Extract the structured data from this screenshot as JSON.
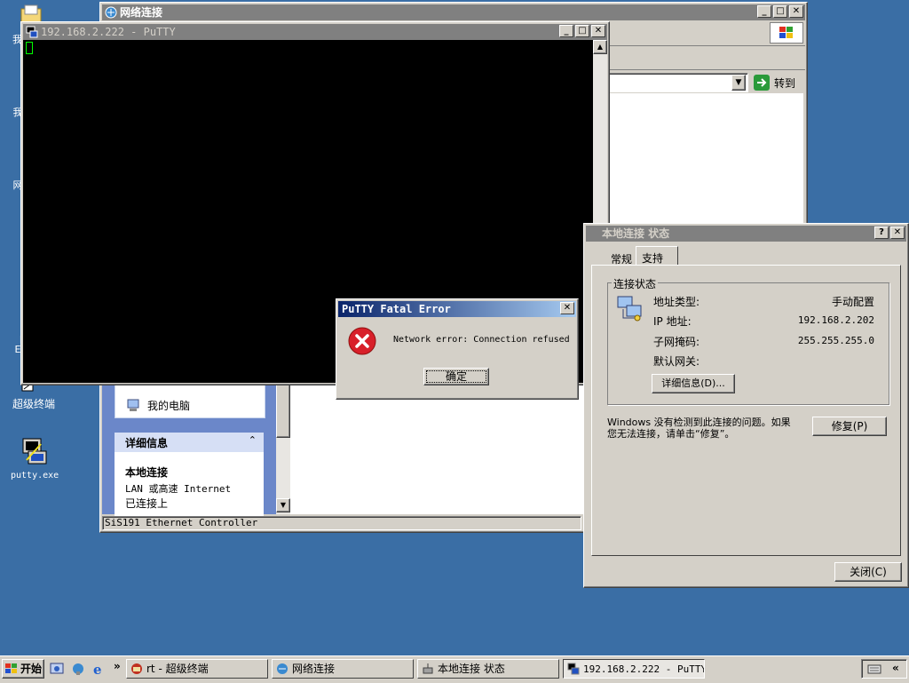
{
  "desktop": {
    "icons": [
      {
        "label": "我",
        "name": "desktop-icon-my-documents"
      },
      {
        "label": "我",
        "name": "desktop-icon-my-computer"
      },
      {
        "label": "网",
        "name": "desktop-icon-network"
      },
      {
        "label": "I\nE",
        "name": "desktop-icon-ie"
      },
      {
        "label": "超级终端",
        "name": "desktop-icon-hyperterminal"
      },
      {
        "label": "putty.exe",
        "name": "desktop-icon-putty"
      }
    ]
  },
  "netconn": {
    "title": "网络连接",
    "go_label": "转到",
    "sidebar": {
      "my_computer": "我的电脑",
      "details_header": "详细信息",
      "conn_name": "本地连接",
      "conn_type": "LAN 或高速 Internet",
      "conn_status": "已连接上"
    },
    "statusbar": "SiS191 Ethernet Controller"
  },
  "putty": {
    "title": "192.168.2.222 - PuTTY"
  },
  "fatal": {
    "title": "PuTTY Fatal Error",
    "message": "Network error: Connection refused",
    "ok_label": "确定"
  },
  "status": {
    "title": "本地连接 状态",
    "tabs": [
      "常规",
      "支持"
    ],
    "group_label": "连接状态",
    "rows": [
      {
        "label": "地址类型:",
        "value": "手动配置"
      },
      {
        "label": "IP 地址:",
        "value": "192.168.2.202"
      },
      {
        "label": "子网掩码:",
        "value": "255.255.255.0"
      },
      {
        "label": "默认网关:",
        "value": ""
      }
    ],
    "details_button": "详细信息(D)...",
    "hint_line1": "Windows 没有检测到此连接的问题。如果",
    "hint_line2": "您无法连接，请单击“修复”。",
    "repair_button": "修复(P)",
    "close_button": "关闭(C)"
  },
  "taskbar": {
    "start": "开始",
    "chevron": "»",
    "items": [
      {
        "label": "rt - 超级终端",
        "name": "taskbar-hyperterminal"
      },
      {
        "label": "网络连接",
        "name": "taskbar-network-connections"
      },
      {
        "label": "本地连接 状态",
        "name": "taskbar-local-connection-status"
      },
      {
        "label": "192.168.2.222 - PuTTY",
        "name": "taskbar-putty"
      }
    ],
    "tray_chevron": "«"
  },
  "colors": {
    "desktop": "#3a6ea5",
    "title_active": "#0a246a",
    "title_inactive": "#808080",
    "error_red": "#d8202a"
  }
}
